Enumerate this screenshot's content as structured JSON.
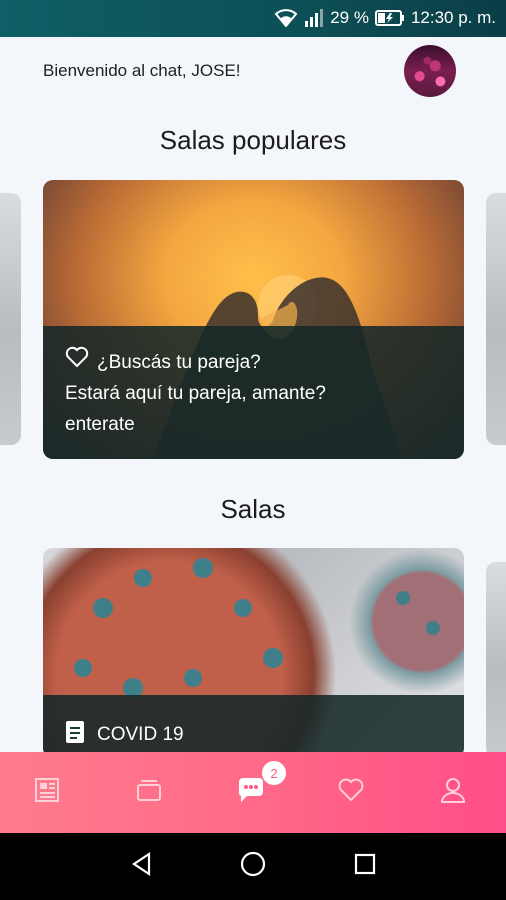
{
  "status_bar": {
    "battery_text": "29 %",
    "time": "12:30 p. m.",
    "icons": [
      "wifi-icon",
      "signal-icon",
      "battery-charging-icon"
    ]
  },
  "header": {
    "greeting": "Bienvenido al chat, JOSE!"
  },
  "popular": {
    "title": "Salas populares",
    "card": {
      "icon": "heart-outline-icon",
      "title": "¿Buscás tu pareja?",
      "line2": "Estará aquí tu pareja, amante?",
      "line3": "enterate"
    }
  },
  "rooms": {
    "title": "Salas",
    "card": {
      "icon": "document-icon",
      "title": "COVID 19"
    }
  },
  "tabbar": {
    "tabs": [
      {
        "name": "news",
        "icon": "newspaper-icon"
      },
      {
        "name": "rooms",
        "icon": "folder-icon"
      },
      {
        "name": "chats",
        "icon": "chat-bubble-icon",
        "badge": "2"
      },
      {
        "name": "favorites",
        "icon": "heart-outline-icon"
      },
      {
        "name": "profile",
        "icon": "user-icon"
      }
    ],
    "color": "#ff5a88"
  },
  "navbar": {
    "icons": [
      "back-icon",
      "home-icon",
      "recents-icon"
    ]
  }
}
